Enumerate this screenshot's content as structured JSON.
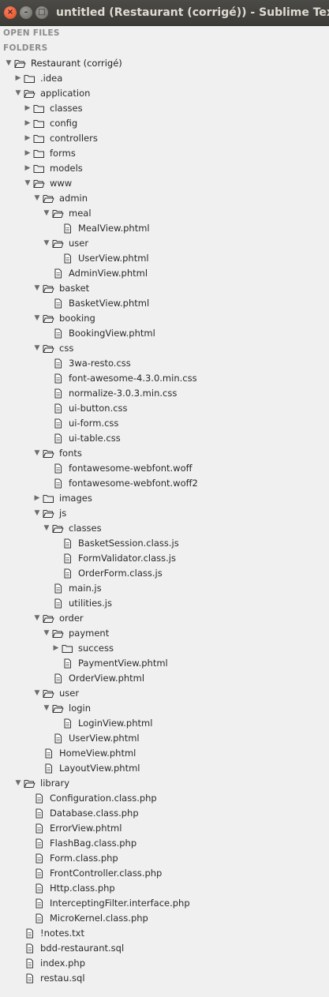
{
  "window": {
    "title": "untitled (Restaurant (corrigé)) - Sublime Text (UN"
  },
  "sidebar": {
    "open_files_header": "OPEN FILES",
    "folders_header": "FOLDERS",
    "tree": [
      {
        "depth": 0,
        "kind": "folder",
        "open": true,
        "label": "Restaurant (corrigé)"
      },
      {
        "depth": 1,
        "kind": "folder",
        "open": false,
        "label": ".idea"
      },
      {
        "depth": 1,
        "kind": "folder",
        "open": true,
        "label": "application"
      },
      {
        "depth": 2,
        "kind": "folder",
        "open": false,
        "label": "classes"
      },
      {
        "depth": 2,
        "kind": "folder",
        "open": false,
        "label": "config"
      },
      {
        "depth": 2,
        "kind": "folder",
        "open": false,
        "label": "controllers"
      },
      {
        "depth": 2,
        "kind": "folder",
        "open": false,
        "label": "forms"
      },
      {
        "depth": 2,
        "kind": "folder",
        "open": false,
        "label": "models"
      },
      {
        "depth": 2,
        "kind": "folder",
        "open": true,
        "label": "www"
      },
      {
        "depth": 3,
        "kind": "folder",
        "open": true,
        "label": "admin"
      },
      {
        "depth": 4,
        "kind": "folder",
        "open": true,
        "label": "meal"
      },
      {
        "depth": 5,
        "kind": "file",
        "label": "MealView.phtml"
      },
      {
        "depth": 4,
        "kind": "folder",
        "open": true,
        "label": "user"
      },
      {
        "depth": 5,
        "kind": "file",
        "label": "UserView.phtml"
      },
      {
        "depth": 4,
        "kind": "file",
        "label": "AdminView.phtml"
      },
      {
        "depth": 3,
        "kind": "folder",
        "open": true,
        "label": "basket"
      },
      {
        "depth": 4,
        "kind": "file",
        "label": "BasketView.phtml"
      },
      {
        "depth": 3,
        "kind": "folder",
        "open": true,
        "label": "booking"
      },
      {
        "depth": 4,
        "kind": "file",
        "label": "BookingView.phtml"
      },
      {
        "depth": 3,
        "kind": "folder",
        "open": true,
        "label": "css"
      },
      {
        "depth": 4,
        "kind": "file",
        "label": "3wa-resto.css"
      },
      {
        "depth": 4,
        "kind": "file",
        "label": "font-awesome-4.3.0.min.css"
      },
      {
        "depth": 4,
        "kind": "file",
        "label": "normalize-3.0.3.min.css"
      },
      {
        "depth": 4,
        "kind": "file",
        "label": "ui-button.css"
      },
      {
        "depth": 4,
        "kind": "file",
        "label": "ui-form.css"
      },
      {
        "depth": 4,
        "kind": "file",
        "label": "ui-table.css"
      },
      {
        "depth": 3,
        "kind": "folder",
        "open": true,
        "label": "fonts"
      },
      {
        "depth": 4,
        "kind": "file",
        "label": "fontawesome-webfont.woff"
      },
      {
        "depth": 4,
        "kind": "file",
        "label": "fontawesome-webfont.woff2"
      },
      {
        "depth": 3,
        "kind": "folder",
        "open": false,
        "label": "images"
      },
      {
        "depth": 3,
        "kind": "folder",
        "open": true,
        "label": "js"
      },
      {
        "depth": 4,
        "kind": "folder",
        "open": true,
        "label": "classes"
      },
      {
        "depth": 5,
        "kind": "file",
        "label": "BasketSession.class.js"
      },
      {
        "depth": 5,
        "kind": "file",
        "label": "FormValidator.class.js"
      },
      {
        "depth": 5,
        "kind": "file",
        "label": "OrderForm.class.js"
      },
      {
        "depth": 4,
        "kind": "file",
        "label": "main.js"
      },
      {
        "depth": 4,
        "kind": "file",
        "label": "utilities.js"
      },
      {
        "depth": 3,
        "kind": "folder",
        "open": true,
        "label": "order"
      },
      {
        "depth": 4,
        "kind": "folder",
        "open": true,
        "label": "payment"
      },
      {
        "depth": 5,
        "kind": "folder",
        "open": false,
        "label": "success"
      },
      {
        "depth": 5,
        "kind": "file",
        "label": "PaymentView.phtml"
      },
      {
        "depth": 4,
        "kind": "file",
        "label": "OrderView.phtml"
      },
      {
        "depth": 3,
        "kind": "folder",
        "open": true,
        "label": "user"
      },
      {
        "depth": 4,
        "kind": "folder",
        "open": true,
        "label": "login"
      },
      {
        "depth": 5,
        "kind": "file",
        "label": "LoginView.phtml"
      },
      {
        "depth": 4,
        "kind": "file",
        "label": "UserView.phtml"
      },
      {
        "depth": 3,
        "kind": "file",
        "label": "HomeView.phtml"
      },
      {
        "depth": 3,
        "kind": "file",
        "label": "LayoutView.phtml"
      },
      {
        "depth": 1,
        "kind": "folder",
        "open": true,
        "label": "library"
      },
      {
        "depth": 2,
        "kind": "file",
        "label": "Configuration.class.php"
      },
      {
        "depth": 2,
        "kind": "file",
        "label": "Database.class.php"
      },
      {
        "depth": 2,
        "kind": "file",
        "label": "ErrorView.phtml"
      },
      {
        "depth": 2,
        "kind": "file",
        "label": "FlashBag.class.php"
      },
      {
        "depth": 2,
        "kind": "file",
        "label": "Form.class.php"
      },
      {
        "depth": 2,
        "kind": "file",
        "label": "FrontController.class.php"
      },
      {
        "depth": 2,
        "kind": "file",
        "label": "Http.class.php"
      },
      {
        "depth": 2,
        "kind": "file",
        "label": "InterceptingFilter.interface.php"
      },
      {
        "depth": 2,
        "kind": "file",
        "label": "MicroKernel.class.php"
      },
      {
        "depth": 1,
        "kind": "file",
        "label": "!notes.txt"
      },
      {
        "depth": 1,
        "kind": "file",
        "label": "bdd-restaurant.sql"
      },
      {
        "depth": 1,
        "kind": "file",
        "label": "index.php"
      },
      {
        "depth": 1,
        "kind": "file",
        "label": "restau.sql"
      }
    ]
  }
}
